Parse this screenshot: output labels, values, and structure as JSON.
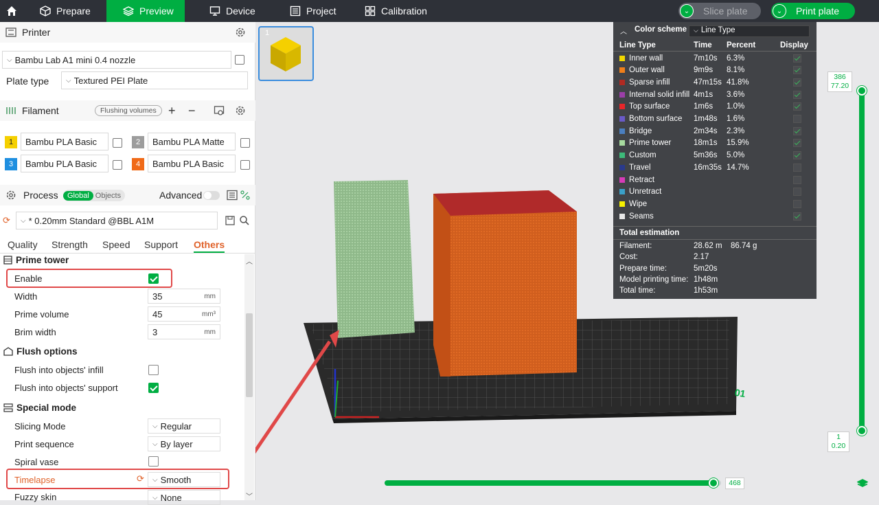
{
  "topbar": {
    "tabs": [
      {
        "label": "Prepare",
        "icon": "cube-icon"
      },
      {
        "label": "Preview",
        "icon": "layers-icon"
      },
      {
        "label": "Device",
        "icon": "monitor-icon"
      },
      {
        "label": "Project",
        "icon": "list-icon"
      },
      {
        "label": "Calibration",
        "icon": "grid-icon"
      }
    ],
    "slice_label": "Slice plate",
    "print_label": "Print plate"
  },
  "printer": {
    "section_title": "Printer",
    "name": "Bambu Lab A1 mini 0.4 nozzle",
    "plate_type_label": "Plate type",
    "plate_type": "Textured PEI Plate"
  },
  "filament": {
    "section_title": "Filament",
    "flushing_label": "Flushing volumes",
    "slots": [
      {
        "num": "1",
        "name": "Bambu PLA Basic",
        "color": "#f5d000"
      },
      {
        "num": "2",
        "name": "Bambu PLA Matte",
        "color": "#9d9d9d"
      },
      {
        "num": "3",
        "name": "Bambu PLA Basic",
        "color": "#1f8fe0"
      },
      {
        "num": "4",
        "name": "Bambu PLA Basic",
        "color": "#f06a18"
      }
    ]
  },
  "process": {
    "section_title": "Process",
    "toggle_global": "Global",
    "toggle_objects": "Objects",
    "advanced_label": "Advanced",
    "preset": "* 0.20mm Standard @BBL A1M",
    "tabs": [
      "Quality",
      "Strength",
      "Speed",
      "Support",
      "Others"
    ]
  },
  "settings": {
    "prime_tower": {
      "title": "Prime tower",
      "enable_label": "Enable",
      "width_label": "Width",
      "width": "35",
      "width_unit": "mm",
      "volume_label": "Prime volume",
      "volume": "45",
      "volume_unit": "mm³",
      "brim_label": "Brim width",
      "brim": "3",
      "brim_unit": "mm"
    },
    "flush": {
      "title": "Flush options",
      "infill_label": "Flush into objects' infill",
      "support_label": "Flush into objects' support"
    },
    "special": {
      "title": "Special mode",
      "slicing_label": "Slicing Mode",
      "slicing": "Regular",
      "sequence_label": "Print sequence",
      "sequence": "By layer",
      "spiral_label": "Spiral vase",
      "timelapse_label": "Timelapse",
      "timelapse": "Smooth",
      "fuzzy_label": "Fuzzy skin",
      "fuzzy": "None"
    }
  },
  "legend": {
    "header": "Color scheme",
    "scheme": "Line Type",
    "col_type": "Line Type",
    "col_time": "Time",
    "col_pct": "Percent",
    "col_display": "Display",
    "rows": [
      {
        "name": "Inner wall",
        "time": "7m10s",
        "pct": "6.3%",
        "color": "#f2d800",
        "on": true
      },
      {
        "name": "Outer wall",
        "time": "9m9s",
        "pct": "8.1%",
        "color": "#f07f1a",
        "on": true
      },
      {
        "name": "Sparse infill",
        "time": "47m15s",
        "pct": "41.8%",
        "color": "#b02a22",
        "on": true
      },
      {
        "name": "Internal solid infill",
        "time": "4m1s",
        "pct": "3.6%",
        "color": "#9b3ea8",
        "on": true
      },
      {
        "name": "Top surface",
        "time": "1m6s",
        "pct": "1.0%",
        "color": "#e8262a",
        "on": true
      },
      {
        "name": "Bottom surface",
        "time": "1m48s",
        "pct": "1.6%",
        "color": "#6a5ac8",
        "on": false
      },
      {
        "name": "Bridge",
        "time": "2m34s",
        "pct": "2.3%",
        "color": "#4a7fc0",
        "on": true
      },
      {
        "name": "Prime tower",
        "time": "18m1s",
        "pct": "15.9%",
        "color": "#a8dca0",
        "on": true
      },
      {
        "name": "Custom",
        "time": "5m36s",
        "pct": "5.0%",
        "color": "#3dbb7a",
        "on": true
      },
      {
        "name": "Travel",
        "time": "16m35s",
        "pct": "14.7%",
        "color": "#2a3a8c",
        "on": false
      },
      {
        "name": "Retract",
        "time": "",
        "pct": "",
        "color": "#d83bb8",
        "on": false
      },
      {
        "name": "Unretract",
        "time": "",
        "pct": "",
        "color": "#3aa0c8",
        "on": false
      },
      {
        "name": "Wipe",
        "time": "",
        "pct": "",
        "color": "#f5f000",
        "on": false
      },
      {
        "name": "Seams",
        "time": "",
        "pct": "",
        "color": "#e8e8e8",
        "on": true
      }
    ],
    "total_title": "Total estimation",
    "filament_label": "Filament:",
    "filament_len": "28.62 m",
    "filament_g": "86.74 g",
    "cost_label": "Cost:",
    "cost": "2.17",
    "prepare_label": "Prepare time:",
    "prepare": "5m20s",
    "model_label": "Model printing time:",
    "model": "1h48m",
    "total_label": "Total time:",
    "total": "1h53m"
  },
  "preview": {
    "thumb_index": "1",
    "plate_number": "01",
    "layer_top": "386",
    "height_top": "77.20",
    "layer_bottom": "1",
    "height_bottom": "0.20",
    "move_value": "468",
    "move_progress": 0.98
  }
}
